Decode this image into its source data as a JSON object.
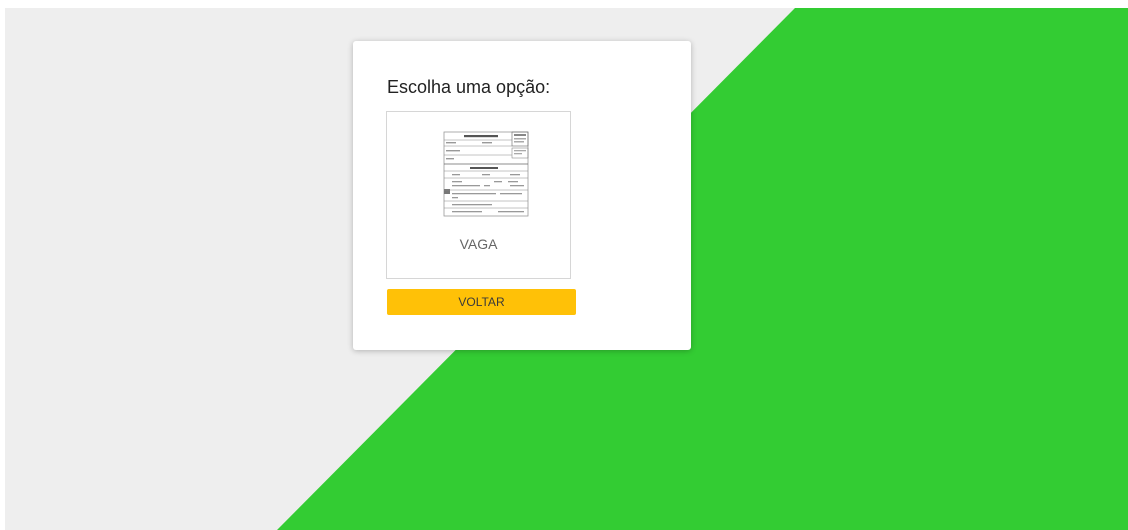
{
  "colors": {
    "background": "#eeeeee",
    "accent_green": "#33cc33",
    "button_yellow": "#ffc107",
    "card": "#ffffff"
  },
  "dialog": {
    "title": "Escolha uma opção:",
    "options": [
      {
        "label": "VAGA",
        "icon": "document-form-thumbnail-icon"
      }
    ],
    "back_button_label": "VOLTAR"
  }
}
